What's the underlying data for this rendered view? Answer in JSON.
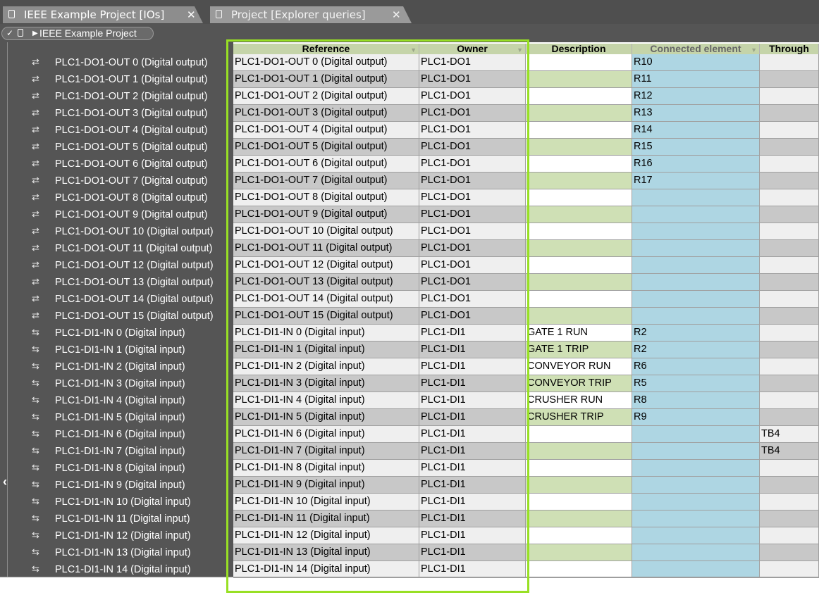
{
  "tabs": [
    {
      "label": "IEEE Example Project [IOs]",
      "active": true
    },
    {
      "label": "Project [Explorer queries]",
      "active": false
    }
  ],
  "breadcrumb": {
    "label": "IEEE Example Project"
  },
  "columns": {
    "reference": "Reference",
    "owner": "Owner",
    "description": "Description",
    "connected": "Connected element",
    "through": "Through"
  },
  "colors": {
    "highlight": "#98e024",
    "header": "#c5d4a9",
    "connected_col": "#aed6e3"
  },
  "tree_items": [
    "PLC1-DO1-OUT 0 (Digital output)",
    "PLC1-DO1-OUT 1 (Digital output)",
    "PLC1-DO1-OUT 2 (Digital output)",
    "PLC1-DO1-OUT 3 (Digital output)",
    "PLC1-DO1-OUT 4 (Digital output)",
    "PLC1-DO1-OUT 5 (Digital output)",
    "PLC1-DO1-OUT 6 (Digital output)",
    "PLC1-DO1-OUT 7 (Digital output)",
    "PLC1-DO1-OUT 8 (Digital output)",
    "PLC1-DO1-OUT 9 (Digital output)",
    "PLC1-DO1-OUT 10 (Digital output)",
    "PLC1-DO1-OUT 11 (Digital output)",
    "PLC1-DO1-OUT 12 (Digital output)",
    "PLC1-DO1-OUT 13 (Digital output)",
    "PLC1-DO1-OUT 14 (Digital output)",
    "PLC1-DO1-OUT 15 (Digital output)",
    "PLC1-DI1-IN 0 (Digital input)",
    "PLC1-DI1-IN 1 (Digital input)",
    "PLC1-DI1-IN 2 (Digital input)",
    "PLC1-DI1-IN 3 (Digital input)",
    "PLC1-DI1-IN 4 (Digital input)",
    "PLC1-DI1-IN 5 (Digital input)",
    "PLC1-DI1-IN 6 (Digital input)",
    "PLC1-DI1-IN 7 (Digital input)",
    "PLC1-DI1-IN 8 (Digital input)",
    "PLC1-DI1-IN 9 (Digital input)",
    "PLC1-DI1-IN 10 (Digital input)",
    "PLC1-DI1-IN 11 (Digital input)",
    "PLC1-DI1-IN 12 (Digital input)",
    "PLC1-DI1-IN 13 (Digital input)",
    "PLC1-DI1-IN 14 (Digital input)"
  ],
  "rows": [
    {
      "reference": "PLC1-DO1-OUT 0 (Digital output)",
      "owner": "PLC1-DO1",
      "description": "",
      "connected": "R10",
      "through": ""
    },
    {
      "reference": "PLC1-DO1-OUT 1 (Digital output)",
      "owner": "PLC1-DO1",
      "description": "",
      "connected": "R11",
      "through": ""
    },
    {
      "reference": "PLC1-DO1-OUT 2 (Digital output)",
      "owner": "PLC1-DO1",
      "description": "",
      "connected": "R12",
      "through": ""
    },
    {
      "reference": "PLC1-DO1-OUT 3 (Digital output)",
      "owner": "PLC1-DO1",
      "description": "",
      "connected": "R13",
      "through": ""
    },
    {
      "reference": "PLC1-DO1-OUT 4 (Digital output)",
      "owner": "PLC1-DO1",
      "description": "",
      "connected": "R14",
      "through": ""
    },
    {
      "reference": "PLC1-DO1-OUT 5 (Digital output)",
      "owner": "PLC1-DO1",
      "description": "",
      "connected": "R15",
      "through": ""
    },
    {
      "reference": "PLC1-DO1-OUT 6 (Digital output)",
      "owner": "PLC1-DO1",
      "description": "",
      "connected": "R16",
      "through": ""
    },
    {
      "reference": "PLC1-DO1-OUT 7 (Digital output)",
      "owner": "PLC1-DO1",
      "description": "",
      "connected": "R17",
      "through": ""
    },
    {
      "reference": "PLC1-DO1-OUT 8 (Digital output)",
      "owner": "PLC1-DO1",
      "description": "",
      "connected": "",
      "through": ""
    },
    {
      "reference": "PLC1-DO1-OUT 9 (Digital output)",
      "owner": "PLC1-DO1",
      "description": "",
      "connected": "",
      "through": ""
    },
    {
      "reference": "PLC1-DO1-OUT 10 (Digital output)",
      "owner": "PLC1-DO1",
      "description": "",
      "connected": "",
      "through": ""
    },
    {
      "reference": "PLC1-DO1-OUT 11 (Digital output)",
      "owner": "PLC1-DO1",
      "description": "",
      "connected": "",
      "through": ""
    },
    {
      "reference": "PLC1-DO1-OUT 12 (Digital output)",
      "owner": "PLC1-DO1",
      "description": "",
      "connected": "",
      "through": ""
    },
    {
      "reference": "PLC1-DO1-OUT 13 (Digital output)",
      "owner": "PLC1-DO1",
      "description": "",
      "connected": "",
      "through": ""
    },
    {
      "reference": "PLC1-DO1-OUT 14 (Digital output)",
      "owner": "PLC1-DO1",
      "description": "",
      "connected": "",
      "through": ""
    },
    {
      "reference": "PLC1-DO1-OUT 15 (Digital output)",
      "owner": "PLC1-DO1",
      "description": "",
      "connected": "",
      "through": ""
    },
    {
      "reference": "PLC1-DI1-IN 0 (Digital input)",
      "owner": "PLC1-DI1",
      "description": "GATE 1 RUN",
      "connected": "R2",
      "through": ""
    },
    {
      "reference": "PLC1-DI1-IN 1 (Digital input)",
      "owner": "PLC1-DI1",
      "description": "GATE 1 TRIP",
      "connected": "R2",
      "through": ""
    },
    {
      "reference": "PLC1-DI1-IN 2 (Digital input)",
      "owner": "PLC1-DI1",
      "description": "CONVEYOR RUN",
      "connected": "R6",
      "through": ""
    },
    {
      "reference": "PLC1-DI1-IN 3 (Digital input)",
      "owner": "PLC1-DI1",
      "description": "CONVEYOR TRIP",
      "connected": "R5",
      "through": ""
    },
    {
      "reference": "PLC1-DI1-IN 4 (Digital input)",
      "owner": "PLC1-DI1",
      "description": "CRUSHER RUN",
      "connected": "R8",
      "through": ""
    },
    {
      "reference": "PLC1-DI1-IN 5 (Digital input)",
      "owner": "PLC1-DI1",
      "description": "CRUSHER TRIP",
      "connected": "R9",
      "through": ""
    },
    {
      "reference": "PLC1-DI1-IN 6 (Digital input)",
      "owner": "PLC1-DI1",
      "description": "",
      "connected": "",
      "through": "TB4"
    },
    {
      "reference": "PLC1-DI1-IN 7 (Digital input)",
      "owner": "PLC1-DI1",
      "description": "",
      "connected": "",
      "through": "TB4"
    },
    {
      "reference": "PLC1-DI1-IN 8 (Digital input)",
      "owner": "PLC1-DI1",
      "description": "",
      "connected": "",
      "through": ""
    },
    {
      "reference": "PLC1-DI1-IN 9 (Digital input)",
      "owner": "PLC1-DI1",
      "description": "",
      "connected": "",
      "through": ""
    },
    {
      "reference": "PLC1-DI1-IN 10 (Digital input)",
      "owner": "PLC1-DI1",
      "description": "",
      "connected": "",
      "through": ""
    },
    {
      "reference": "PLC1-DI1-IN 11 (Digital input)",
      "owner": "PLC1-DI1",
      "description": "",
      "connected": "",
      "through": ""
    },
    {
      "reference": "PLC1-DI1-IN 12 (Digital input)",
      "owner": "PLC1-DI1",
      "description": "",
      "connected": "",
      "through": ""
    },
    {
      "reference": "PLC1-DI1-IN 13 (Digital input)",
      "owner": "PLC1-DI1",
      "description": "",
      "connected": "",
      "through": ""
    },
    {
      "reference": "PLC1-DI1-IN 14 (Digital input)",
      "owner": "PLC1-DI1",
      "description": "",
      "connected": "",
      "through": ""
    }
  ]
}
